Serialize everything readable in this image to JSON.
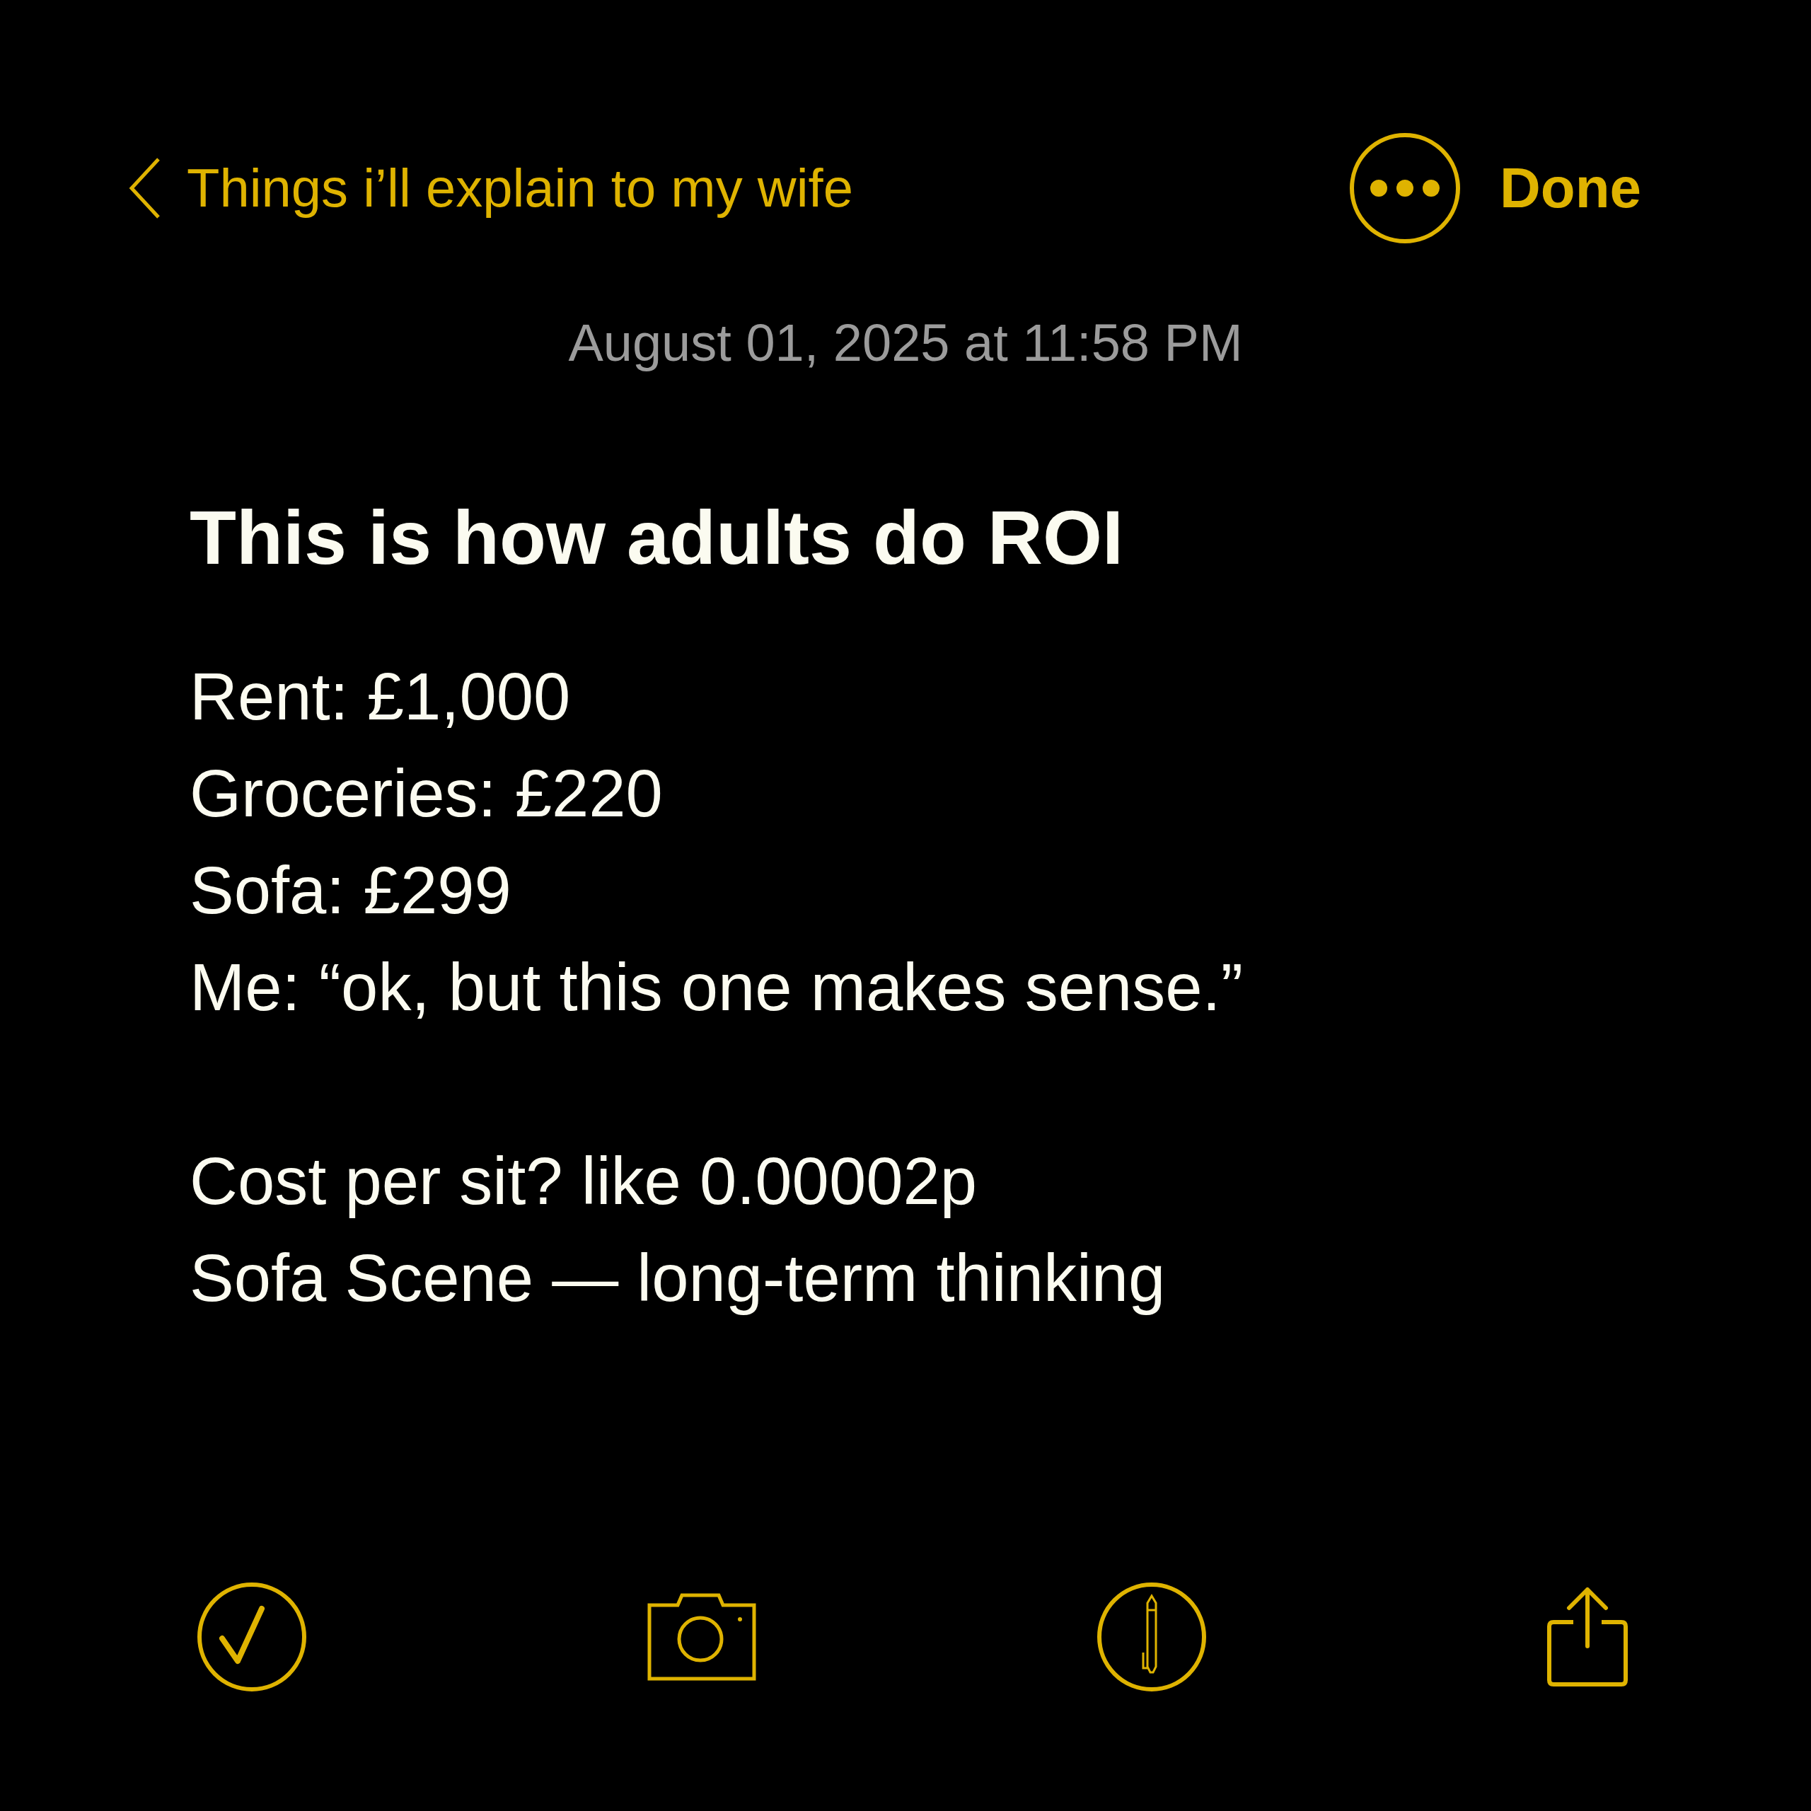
{
  "nav": {
    "back_label": "Things i’ll explain to my wife",
    "done_label": "Done"
  },
  "date": "August 01, 2025 at 11:58 PM",
  "note": {
    "title": "This is how adults do ROI",
    "paragraphs": [
      [
        "Rent: £1,000",
        "Groceries: £220",
        "Sofa: £299",
        "Me: “ok, but this one makes sense.”"
      ],
      [
        "Cost per sit? like 0.00002p",
        "Sofa Scene — long-term thinking"
      ]
    ]
  }
}
